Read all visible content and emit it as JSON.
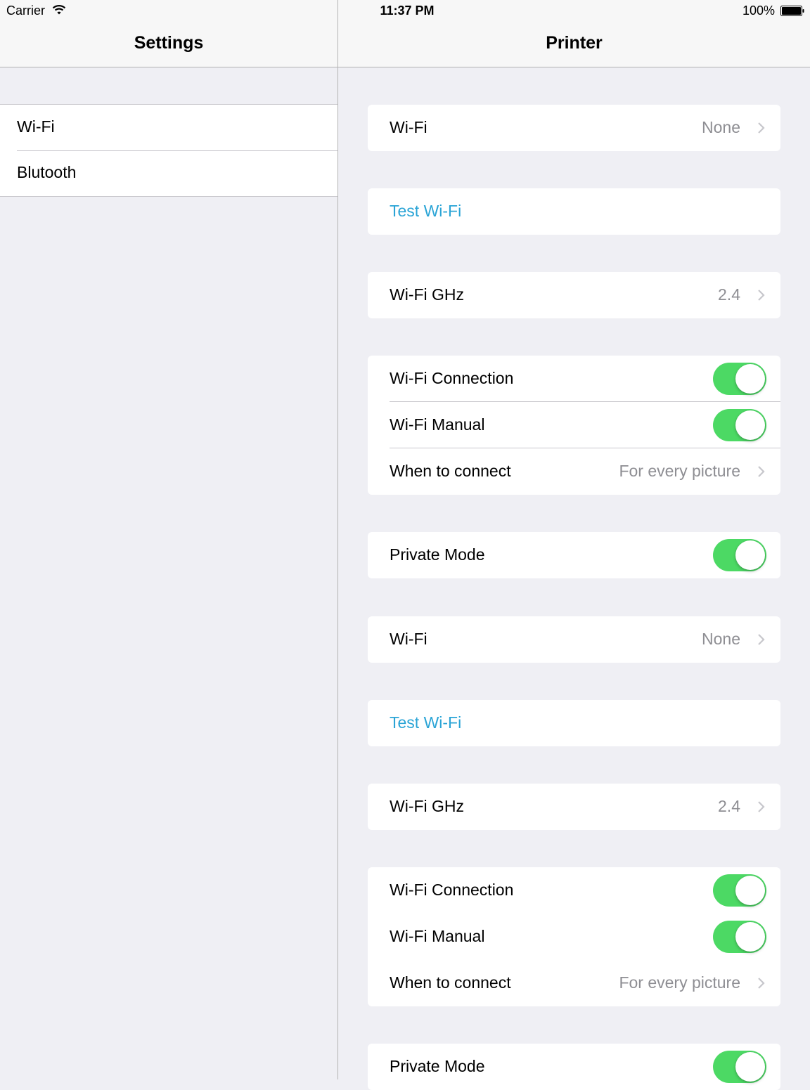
{
  "status_bar": {
    "carrier": "Carrier",
    "time": "11:37 PM",
    "battery": "100%"
  },
  "master": {
    "title": "Settings",
    "items": [
      {
        "label": "Wi-Fi"
      },
      {
        "label": "Blutooth"
      }
    ]
  },
  "detail": {
    "title": "Printer",
    "wifi_label": "Wi-Fi",
    "wifi_value": "None",
    "test_wifi": "Test Wi-Fi",
    "ghz_label": "Wi-Fi GHz",
    "ghz_value": "2.4",
    "connection_label": "Wi-Fi Connection",
    "manual_label": "Wi-Fi Manual",
    "when_label": "When to connect",
    "when_value": "For every picture",
    "private_label": "Private Mode",
    "toggles": {
      "connection": true,
      "manual": true,
      "private": true
    }
  },
  "colors": {
    "accent": "#2aa4d6",
    "toggle_on": "#4cd964",
    "background": "#efeff4"
  },
  "icons": [
    "wifi-icon",
    "battery-icon",
    "chevron-right-icon"
  ]
}
